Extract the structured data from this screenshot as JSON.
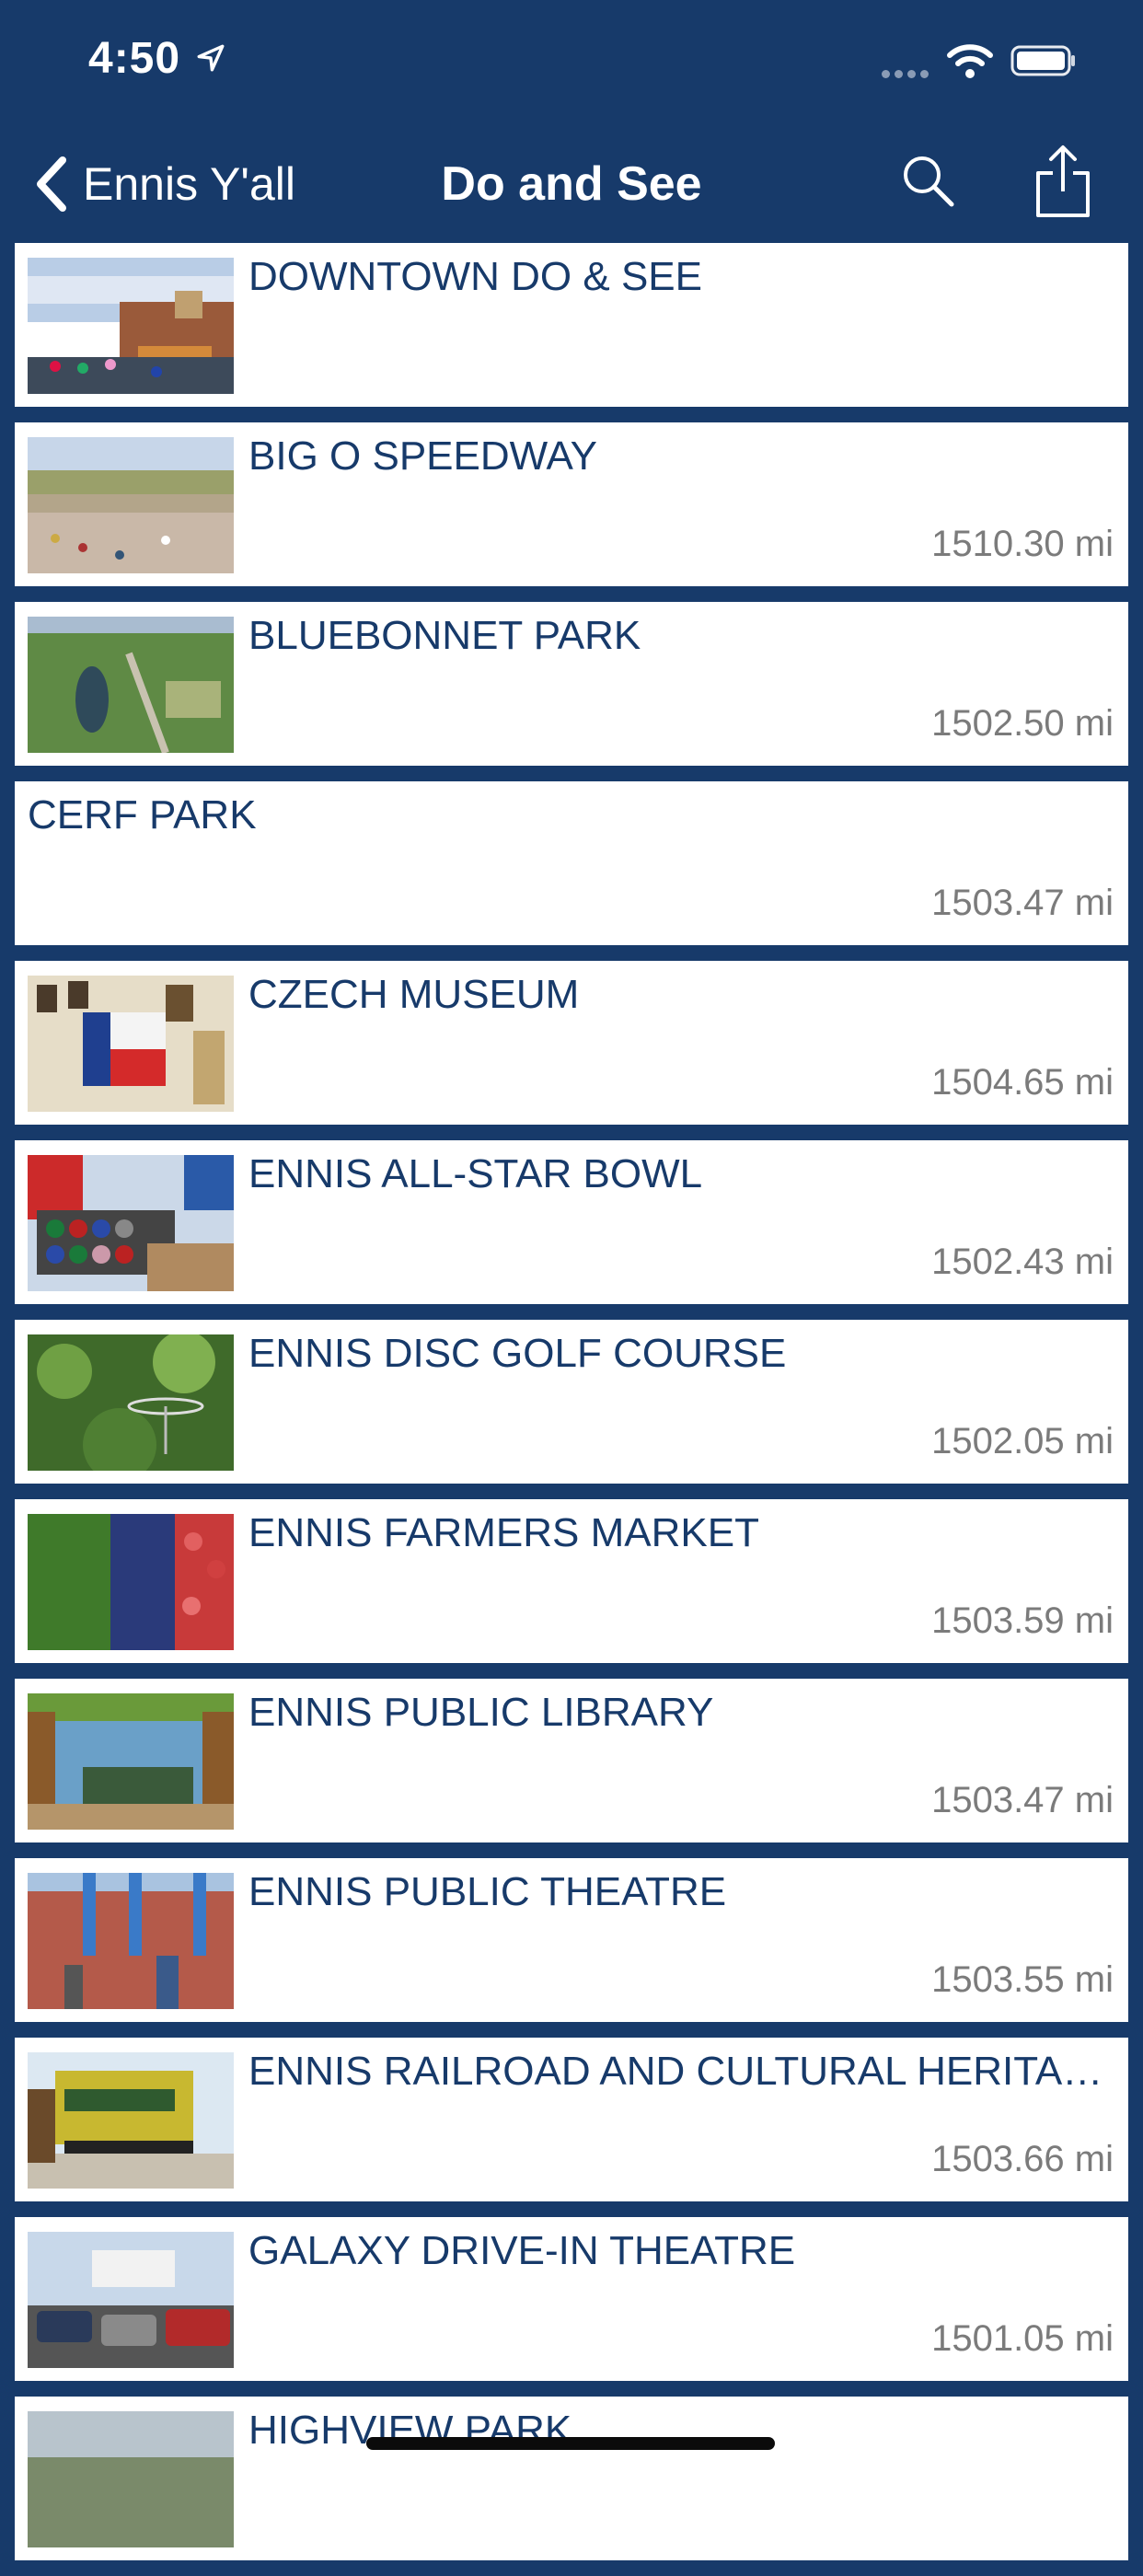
{
  "status_bar": {
    "time": "4:50"
  },
  "nav": {
    "back_label": "Ennis Y'all",
    "title": "Do and See"
  },
  "items": [
    {
      "title": "DOWNTOWN DO & SEE",
      "distance": "",
      "image": "downtown-photo"
    },
    {
      "title": "BIG O SPEEDWAY",
      "distance": "1510.30 mi",
      "image": "speedway-photo"
    },
    {
      "title": "BLUEBONNET PARK",
      "distance": "1502.50 mi",
      "image": "park-aerial-photo"
    },
    {
      "title": "CERF PARK",
      "distance": "1503.47 mi",
      "image": ""
    },
    {
      "title": "CZECH MUSEUM",
      "distance": "1504.65 mi",
      "image": "museum-photo"
    },
    {
      "title": "ENNIS ALL-STAR BOWL",
      "distance": "1502.43 mi",
      "image": "bowling-photo"
    },
    {
      "title": "ENNIS DISC GOLF COURSE",
      "distance": "1502.05 mi",
      "image": "disc-golf-photo"
    },
    {
      "title": "ENNIS FARMERS MARKET",
      "distance": "1503.59 mi",
      "image": "produce-photo"
    },
    {
      "title": "ENNIS PUBLIC LIBRARY",
      "distance": "1503.47 mi",
      "image": "library-photo"
    },
    {
      "title": "ENNIS PUBLIC THEATRE",
      "distance": "1503.55 mi",
      "image": "theatre-photo"
    },
    {
      "title": "ENNIS RAILROAD AND CULTURAL HERITAG...",
      "distance": "1503.66 mi",
      "image": "railcar-photo"
    },
    {
      "title": "GALAXY DRIVE-IN THEATRE",
      "distance": "1501.05 mi",
      "image": "drive-in-photo"
    },
    {
      "title": "HIGHVIEW PARK",
      "distance": "",
      "image": "highview-photo"
    }
  ]
}
